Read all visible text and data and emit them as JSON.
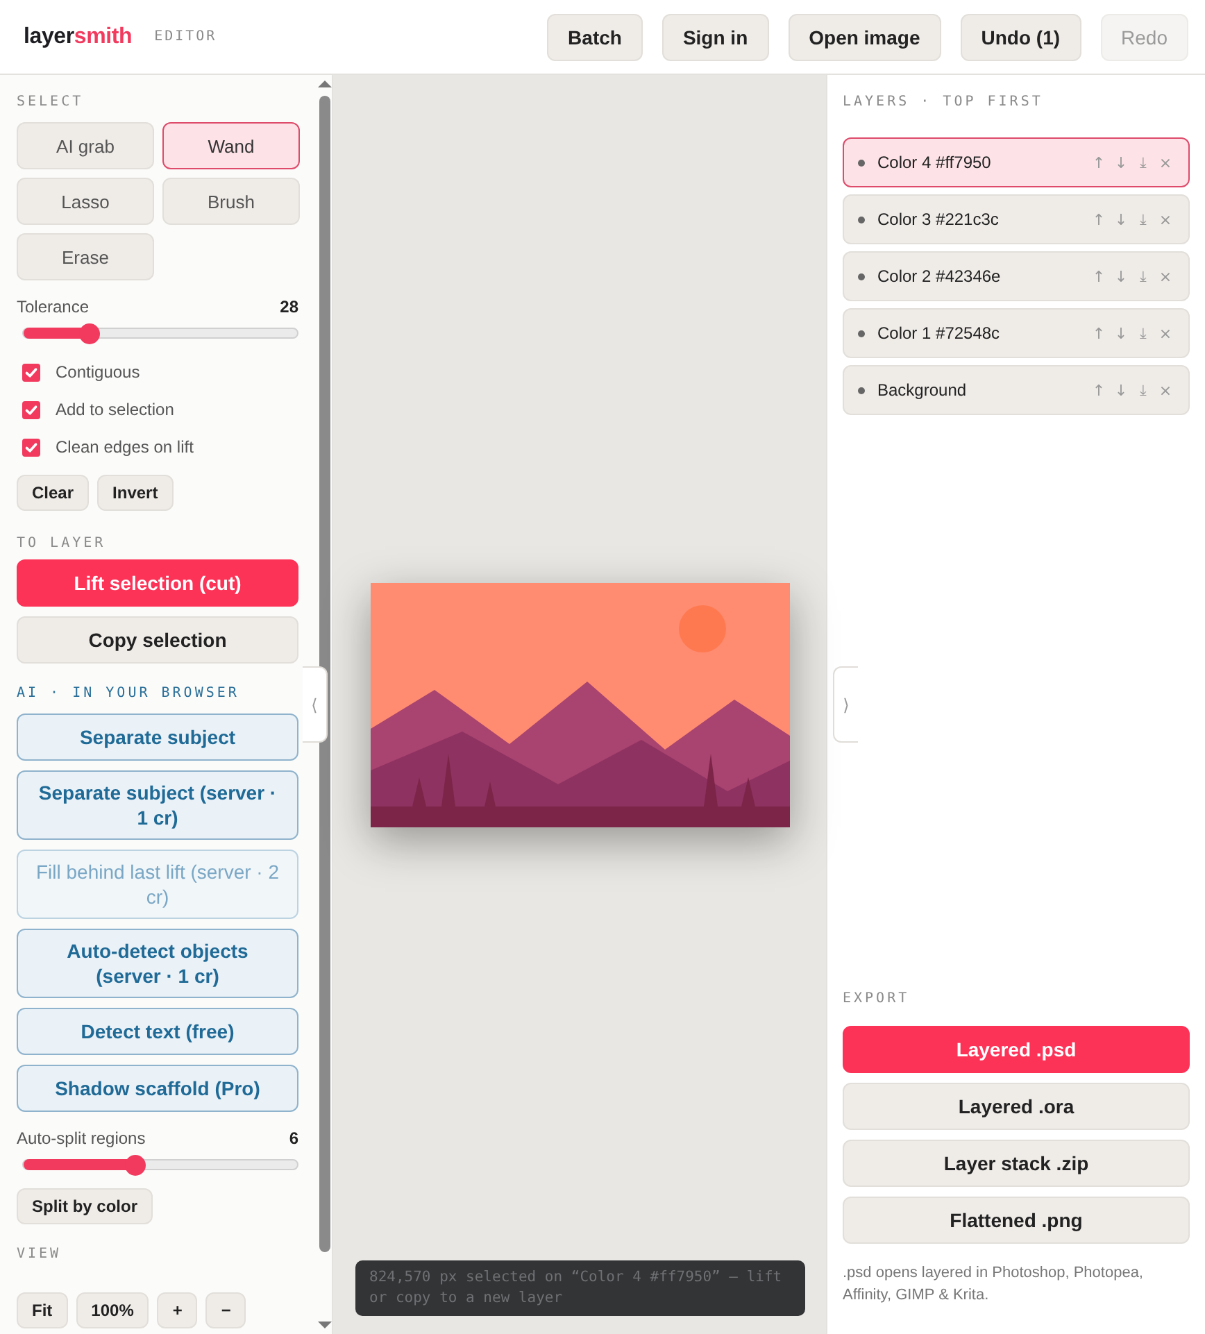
{
  "app": {
    "logo_dark": "layer",
    "logo_accent": "smith",
    "badge": "EDITOR"
  },
  "toolbar": [
    {
      "label": "Batch",
      "disabled": false
    },
    {
      "label": "Sign in",
      "disabled": false
    },
    {
      "label": "Open image",
      "disabled": false
    },
    {
      "label": "Undo (1)",
      "disabled": false
    },
    {
      "label": "Redo",
      "disabled": true
    }
  ],
  "select": {
    "heading": "SELECT",
    "tools": [
      {
        "label": "AI grab",
        "selected": false
      },
      {
        "label": "Wand",
        "selected": true
      },
      {
        "label": "Lasso",
        "selected": false
      },
      {
        "label": "Brush",
        "selected": false
      },
      {
        "label": "Erase",
        "selected": false
      }
    ],
    "tolerance": {
      "label": "Tolerance",
      "reading": "28",
      "level": 0.24
    },
    "options": [
      {
        "label": "Contiguous",
        "checked": true
      },
      {
        "label": "Add to selection",
        "checked": true
      },
      {
        "label": "Clean edges on lift",
        "checked": true
      }
    ],
    "actions": [
      "Clear",
      "Invert"
    ]
  },
  "to_layer": {
    "heading": "TO LAYER",
    "buttons": [
      {
        "label": "Lift selection (cut)",
        "kind": "primary"
      },
      {
        "label": "Copy selection",
        "kind": "secondary"
      }
    ]
  },
  "ai": {
    "heading": "AI · IN YOUR BROWSER",
    "buttons": [
      {
        "label": "Separate subject",
        "disabled": false
      },
      {
        "label": "Separate subject (server · 1 cr)",
        "disabled": false
      },
      {
        "label": "Fill behind last lift (server · 2 cr)",
        "disabled": true
      },
      {
        "label": "Auto-detect objects (server · 1 cr)",
        "disabled": false
      },
      {
        "label": "Detect text (free)",
        "disabled": false
      },
      {
        "label": "Shadow scaffold (Pro)",
        "disabled": false
      }
    ],
    "regions": {
      "label": "Auto-split regions",
      "reading": "6",
      "level": 0.41
    },
    "split_button": "Split by color"
  },
  "view": {
    "heading": "VIEW",
    "buttons": [
      "Fit",
      "100%",
      "+",
      "−"
    ]
  },
  "canvas": {
    "collapse_left": "⟨",
    "collapse_right": "⟩",
    "status": "824,570 px selected on “Color 4 #ff7950” — lift or copy to a new layer"
  },
  "layers": {
    "heading": "LAYERS · TOP FIRST",
    "items": [
      {
        "name": "Color 4 #ff7950",
        "selected": true,
        "actions": [
          "↑",
          "↓",
          "⤓",
          "×"
        ]
      },
      {
        "name": "Color 3 #221c3c",
        "selected": false,
        "actions": [
          "↑",
          "↓",
          "⤓",
          "×"
        ]
      },
      {
        "name": "Color 2 #42346e",
        "selected": false,
        "actions": [
          "↑",
          "↓",
          "⤓",
          "×"
        ]
      },
      {
        "name": "Color 1 #72548c",
        "selected": false,
        "actions": [
          "↑",
          "↓",
          "⤓",
          "×"
        ]
      },
      {
        "name": "Background",
        "selected": false,
        "actions": [
          "↑",
          "↓",
          "⤓",
          "×"
        ]
      }
    ]
  },
  "export": {
    "heading": "EXPORT",
    "buttons": [
      {
        "label": "Layered .psd",
        "kind": "primary"
      },
      {
        "label": "Layered .ora",
        "kind": "secondary"
      },
      {
        "label": "Layer stack .zip",
        "kind": "secondary"
      },
      {
        "label": "Flattened .png",
        "kind": "secondary"
      }
    ],
    "note": ".psd opens layered in Photoshop, Photopea, Affinity, GIMP & Krita."
  }
}
